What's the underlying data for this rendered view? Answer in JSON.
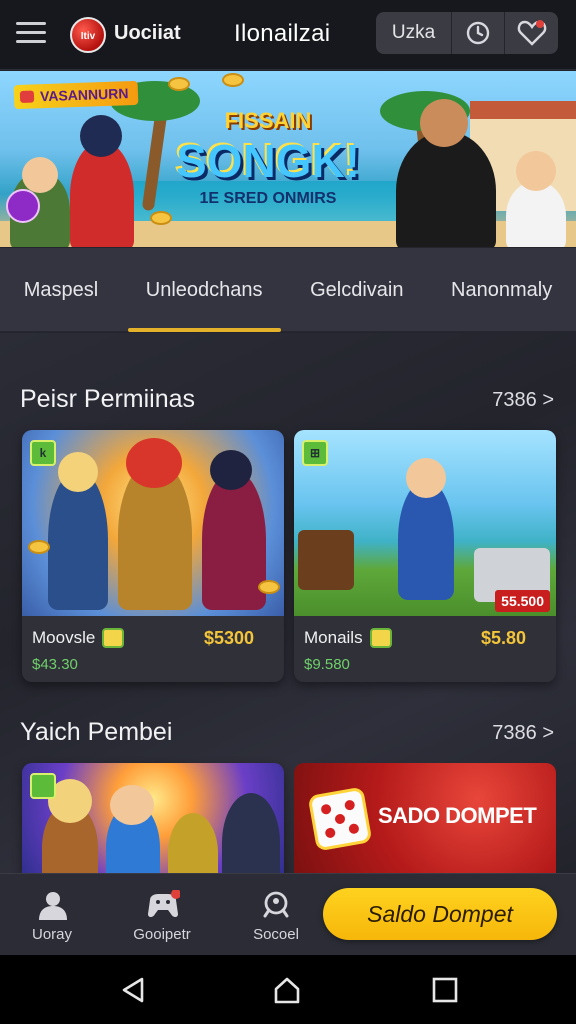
{
  "header": {
    "logo_badge": "Itiv",
    "logo_text": "Uociiat",
    "title": "Ilonailzai",
    "action_label": "Uzka"
  },
  "hero": {
    "tag": "VASANNURN",
    "title_top": "FISSAIN",
    "title_main": "SONGK!",
    "subtitle": "1E SRED ONMIRS"
  },
  "tabs": [
    {
      "label": "Maspesl",
      "active": false
    },
    {
      "label": "Unleodchans",
      "active": true
    },
    {
      "label": "Gelcdivain",
      "active": false
    },
    {
      "label": "Nanonmaly",
      "active": false
    }
  ],
  "sections": [
    {
      "title": "Peisr Permiinas",
      "more": "7386 >",
      "cards": [
        {
          "name": "Moovsle",
          "price": "$5300",
          "sub": "$43.30",
          "badge": "k"
        },
        {
          "name": "Monails",
          "price": "$5.80",
          "sub": "$9.580",
          "badge": "⊞",
          "tag": "55.500"
        }
      ]
    },
    {
      "title": "Yaich Pembei",
      "more": "7386 >",
      "promo": "SADO DOMPET"
    }
  ],
  "bottom_nav": [
    {
      "label": "Uoray",
      "icon": "user-icon"
    },
    {
      "label": "Gooipetr",
      "icon": "game-controller-icon"
    },
    {
      "label": "Socoel",
      "icon": "search-icon"
    }
  ],
  "cta_label": "Saldo Dompet",
  "colors": {
    "accent": "#e3b22a",
    "cta": "#ffd21f",
    "price": "#f3c53a",
    "sub_price": "#6fd06a",
    "background": "#23242d"
  }
}
